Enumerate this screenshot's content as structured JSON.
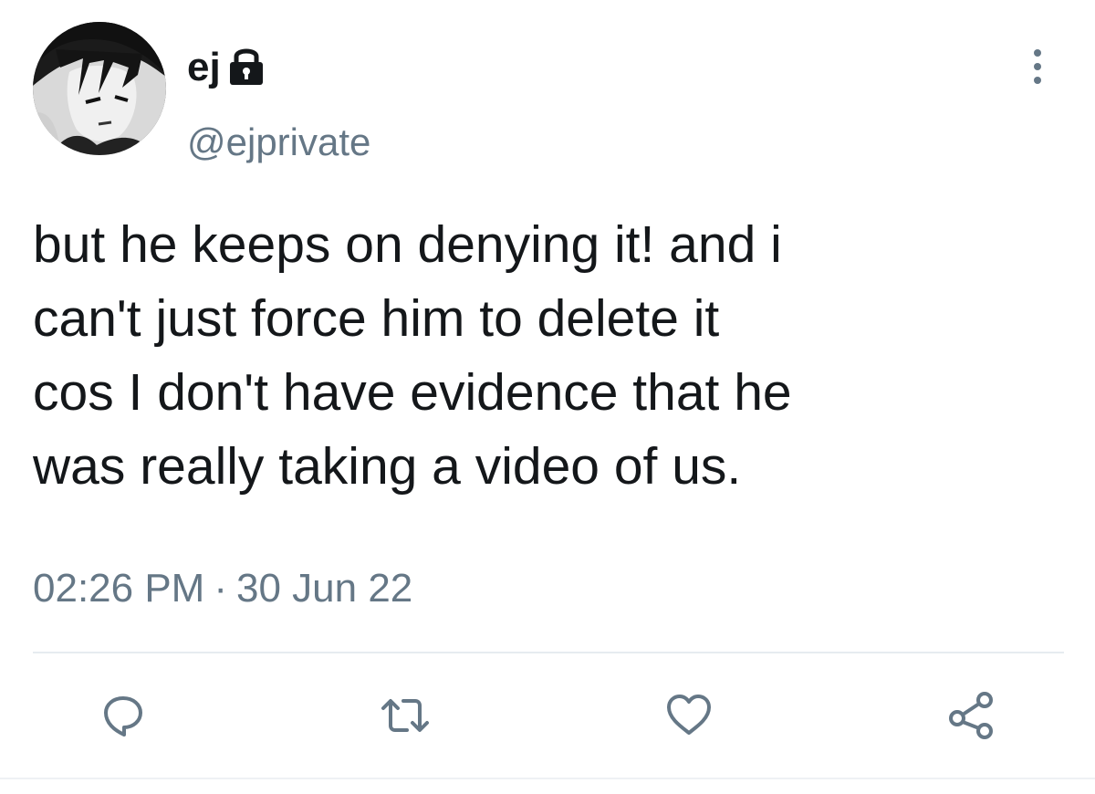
{
  "user": {
    "display_name": "ej",
    "handle": "@ejprivate",
    "avatar_icon": "anime-avatar",
    "protected_icon": "lock-icon"
  },
  "tweet": {
    "text": "but he keeps on denying it! and i\ncan't just force him to delete it\ncos I don't have evidence that he\nwas really taking a video of us.",
    "time": "02:26 PM",
    "separator": "·",
    "date": "30 Jun 22"
  },
  "actions": [
    {
      "name": "reply",
      "icon": "reply-icon"
    },
    {
      "name": "retweet",
      "icon": "retweet-icon"
    },
    {
      "name": "like",
      "icon": "heart-icon"
    },
    {
      "name": "share",
      "icon": "share-icon"
    }
  ],
  "colors": {
    "text": "#14171a",
    "secondary": "#657786",
    "divider": "#e6ecf0"
  }
}
